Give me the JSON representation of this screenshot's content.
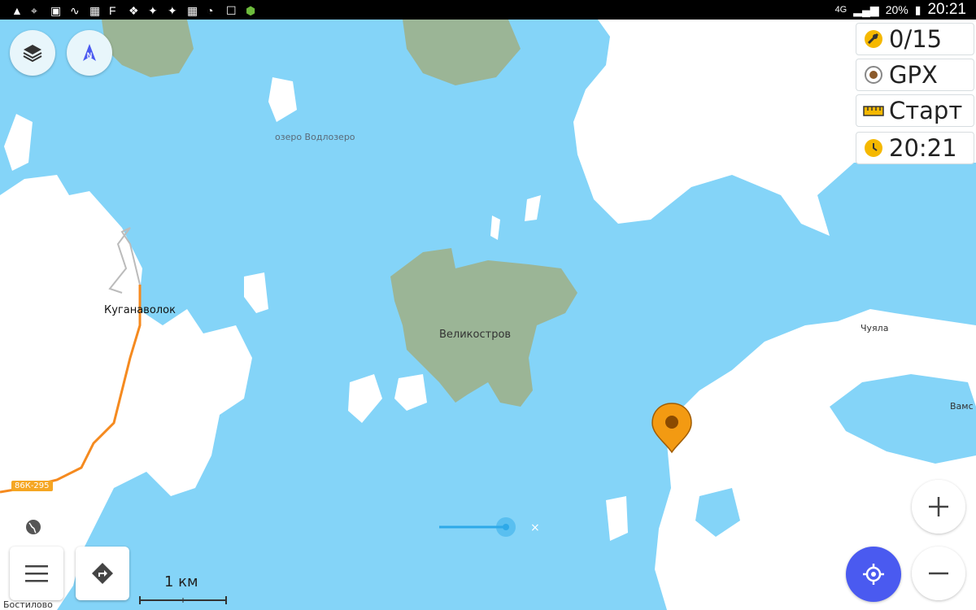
{
  "status_bar": {
    "network": "4G",
    "battery": "20%",
    "time": "20:21"
  },
  "widgets": {
    "satellites": "0/15",
    "gpx": "GPX",
    "ruler": "Старт",
    "clock": "20:21"
  },
  "map_labels": {
    "lake": "озеро Водлозеро",
    "village1": "Куганаволок",
    "island": "Великостров",
    "place1": "Чуяла",
    "place2": "Вамс",
    "place3": "Бостилово",
    "road": "86К-295"
  },
  "scale": "1 км",
  "nav": {
    "compass_letter": "N"
  },
  "colors": {
    "water": "#84d4f8",
    "land": "#ffffff",
    "forest": "#9bb596",
    "accent": "#4a5af0",
    "marker": "#f39a12",
    "road": "#f58a1f"
  },
  "icons": {
    "layers": "layers-icon",
    "compass": "compass-icon",
    "menu": "menu-icon",
    "route": "route-icon",
    "globe": "globe-icon",
    "my_location": "crosshair-icon",
    "zoom_in": "plus-icon",
    "zoom_out": "minus-icon"
  }
}
